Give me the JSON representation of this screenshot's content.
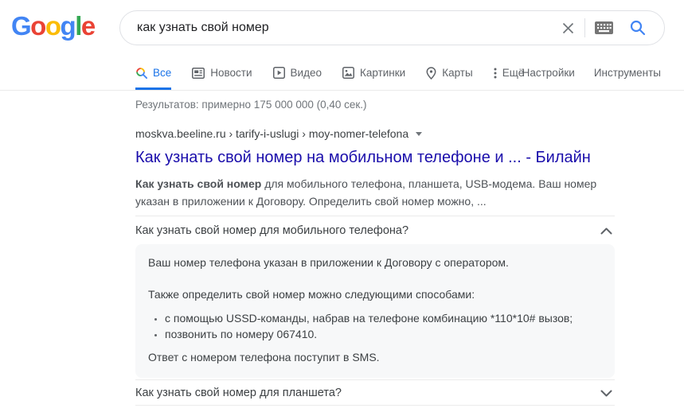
{
  "header": {
    "logo": {
      "letters": [
        {
          "ch": "G",
          "color": "#4285F4"
        },
        {
          "ch": "o",
          "color": "#EA4335"
        },
        {
          "ch": "o",
          "color": "#FBBC05"
        },
        {
          "ch": "g",
          "color": "#4285F4"
        },
        {
          "ch": "l",
          "color": "#34A853"
        },
        {
          "ch": "e",
          "color": "#EA4335"
        }
      ]
    },
    "search": {
      "value": "как узнать свой номер",
      "icons": [
        "clear-icon",
        "keyboard-icon",
        "search-icon"
      ]
    }
  },
  "tabs": {
    "items": [
      {
        "label": "Все",
        "icon": "search-icon",
        "active": true
      },
      {
        "label": "Новости",
        "icon": "news-icon",
        "active": false
      },
      {
        "label": "Видео",
        "icon": "video-icon",
        "active": false
      },
      {
        "label": "Картинки",
        "icon": "images-icon",
        "active": false
      },
      {
        "label": "Карты",
        "icon": "maps-icon",
        "active": false
      },
      {
        "label": "Ещё",
        "icon": "more-icon",
        "active": false
      }
    ],
    "right_items": [
      {
        "label": "Настройки"
      },
      {
        "label": "Инструменты"
      }
    ],
    "active_color": "#1a73e8"
  },
  "stats": {
    "text": "Результатов: примерно 175 000 000 (0,40 сек.)"
  },
  "result": {
    "breadcrumb": "moskva.beeline.ru › tarify-i-uslugi › moy-nomer-telefona",
    "title": "Как узнать свой номер на мобильном телефоне и ... - Билайн",
    "title_color": "#1a0dab",
    "snippet_bold": "Как узнать свой номер",
    "snippet_rest": " для мобильного телефона, планшета, USB-модема. Ваш номер указан в приложении к Договору. Определить свой номер можно, ..."
  },
  "faq": {
    "expanded": {
      "question": "Как узнать свой номер для мобильного телефона?",
      "state_icon": "chevron-up-icon",
      "answer_p1": "Ваш номер телефона указан в приложении к Договору с оператором.",
      "answer_p2": "Также определить свой номер можно следующими способами:",
      "bullets": [
        "с помощью USSD-команды, набрав на телефоне комбинацию *110*10# вызов;",
        "позвонить по номеру 067410."
      ],
      "answer_p3": "Ответ с номером телефона поступит в SMS."
    },
    "collapsed": {
      "question": "Как узнать свой номер для планшета?",
      "state_icon": "chevron-down-icon"
    }
  },
  "colors": {
    "accent_blue": "#1a73e8",
    "link_blue": "#1a0dab",
    "text_dark": "#3c4043",
    "text_gray": "#70757a",
    "snippet_gray": "#4d5156",
    "box_bg": "#f7f8f9",
    "divider": "#ebebeb"
  }
}
